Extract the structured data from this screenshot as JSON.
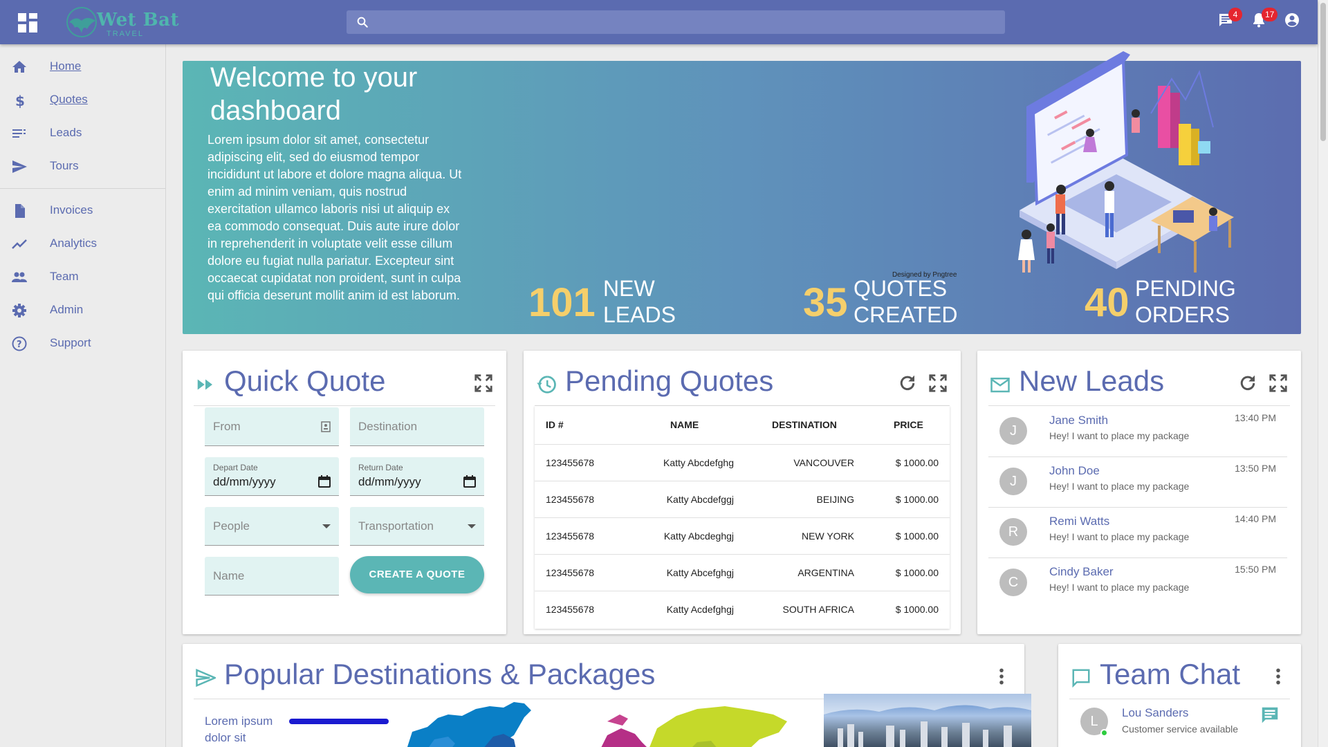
{
  "header": {
    "logo_title": "Wet Bat",
    "logo_sub": "TRAVEL",
    "search_placeholder": "",
    "messages_badge": "4",
    "notifications_badge": "17"
  },
  "sidebar": {
    "items": [
      {
        "label": "Home"
      },
      {
        "label": "Quotes"
      },
      {
        "label": "Leads"
      },
      {
        "label": "Tours"
      },
      {
        "label": "Invoices"
      },
      {
        "label": "Analytics"
      },
      {
        "label": "Team"
      },
      {
        "label": "Admin"
      },
      {
        "label": "Support"
      }
    ]
  },
  "hero": {
    "title": "Welcome to your dashboard",
    "body": "Lorem ipsum dolor sit amet, consectetur adipiscing elit, sed do eiusmod tempor incididunt ut labore et dolore magna aliqua. Ut enim ad minim veniam, quis nostrud exercitation ullamco laboris nisi ut aliquip ex ea commodo consequat. Duis aute irure dolor in reprehenderit in voluptate velit esse cillum dolore eu fugiat nulla pariatur. Excepteur sint occaecat cupidatat non proident, sunt in culpa qui officia deserunt mollit anim id est laborum.",
    "credit": "Designed by Pngtree",
    "stats": [
      {
        "num": "101",
        "l1": "NEW",
        "l2": "LEADS"
      },
      {
        "num": "35",
        "l1": "QUOTES",
        "l2": "CREATED"
      },
      {
        "num": "40",
        "l1": "PENDING",
        "l2": "ORDERS"
      }
    ]
  },
  "quick_quote": {
    "title": "Quick Quote",
    "from_placeholder": "From",
    "destination_placeholder": "Destination",
    "depart_label": "Depart Date",
    "depart_value": "dd/mm/yyyy",
    "return_label": "Return Date",
    "return_value": "dd/mm/yyyy",
    "people_placeholder": "People",
    "transport_placeholder": "Transportation",
    "name_placeholder": "Name",
    "create_button": "CREATE A QUOTE"
  },
  "pending_quotes": {
    "title": "Pending Quotes",
    "columns": [
      "ID #",
      "NAME",
      "DESTINATION",
      "PRICE"
    ],
    "rows": [
      {
        "id": "123455678",
        "name": "Katty Abcdefghg",
        "destination": "VANCOUVER",
        "price": "$ 1000.00"
      },
      {
        "id": "123455678",
        "name": "Katty Abcdefggj",
        "destination": "BEIJING",
        "price": "$ 1000.00"
      },
      {
        "id": "123455678",
        "name": "Katty Abcdeghgj",
        "destination": "NEW YORK",
        "price": "$ 1000.00"
      },
      {
        "id": "123455678",
        "name": "Katty Abcefghgj",
        "destination": "ARGENTINA",
        "price": "$ 1000.00"
      },
      {
        "id": "123455678",
        "name": "Katty Acdefghgj",
        "destination": "SOUTH AFRICA",
        "price": "$ 1000.00"
      }
    ]
  },
  "new_leads": {
    "title": "New Leads",
    "items": [
      {
        "initial": "J",
        "name": "Jane Smith",
        "message": "Hey! I want to place my package",
        "time": "13:40 PM"
      },
      {
        "initial": "J",
        "name": "John Doe",
        "message": "Hey! I want to place my package",
        "time": "13:50 PM"
      },
      {
        "initial": "R",
        "name": "Remi Watts",
        "message": "Hey! I want to place my package",
        "time": "14:40 PM"
      },
      {
        "initial": "C",
        "name": "Cindy Baker",
        "message": "Hey! I want to place my package",
        "time": "15:50 PM"
      }
    ]
  },
  "destinations": {
    "title": "Popular Destinations & Packages",
    "side_text": "Lorem ipsum dolor sit"
  },
  "team_chat": {
    "title": "Team Chat",
    "contact_initial": "L",
    "contact_name": "Lou Sanders",
    "contact_status": "Customer service available"
  },
  "colors": {
    "primary": "#5b6bb0",
    "teal": "#5bb6b5",
    "stat_yellow": "#f5cf6b",
    "badge_red": "#e5252f"
  }
}
